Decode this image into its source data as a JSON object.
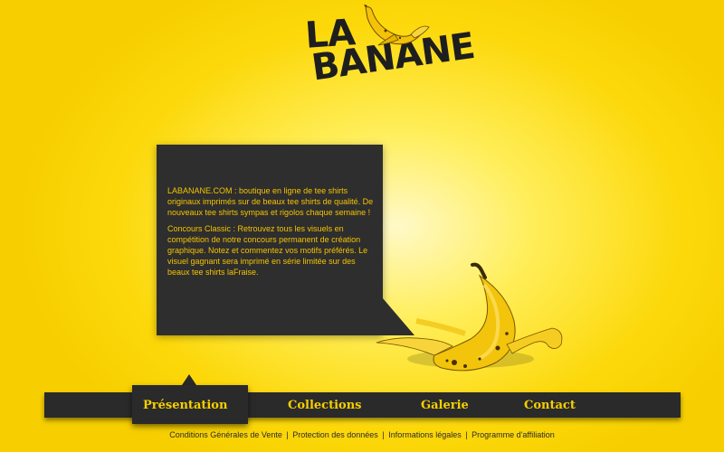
{
  "logo": {
    "line1": "LA",
    "line2": "BANANE"
  },
  "content": {
    "paragraph1": "LABANANE.COM : boutique en ligne de tee shirts originaux imprimés sur de beaux tee shirts de qualité. De nouveaux tee shirts sympas et rigolos chaque semaine !",
    "paragraph2": "Concours Classic : Retrouvez tous les visuels en compétition de notre concours permanent de création graphique. Notez et commentez vos motifs préférés. Le visuel gagnant sera imprimé en série limitée sur des beaux tee shirts laFraise."
  },
  "nav": {
    "items": [
      {
        "label": "Présentation",
        "active": true
      },
      {
        "label": "Collections",
        "active": false
      },
      {
        "label": "Galerie",
        "active": false
      },
      {
        "label": "Contact",
        "active": false
      }
    ]
  },
  "footer": {
    "links": [
      "Conditions Générales de Vente",
      "Protection des données",
      "Informations légales",
      "Programme d'affiliation"
    ],
    "separator": "|"
  },
  "colors": {
    "background": "#f7cf00",
    "dark": "#2a2a2a",
    "accent": "#f5c400"
  },
  "icons": {
    "logo_banana": "banana-peel-icon",
    "illustration": "banana-peel-icon"
  }
}
